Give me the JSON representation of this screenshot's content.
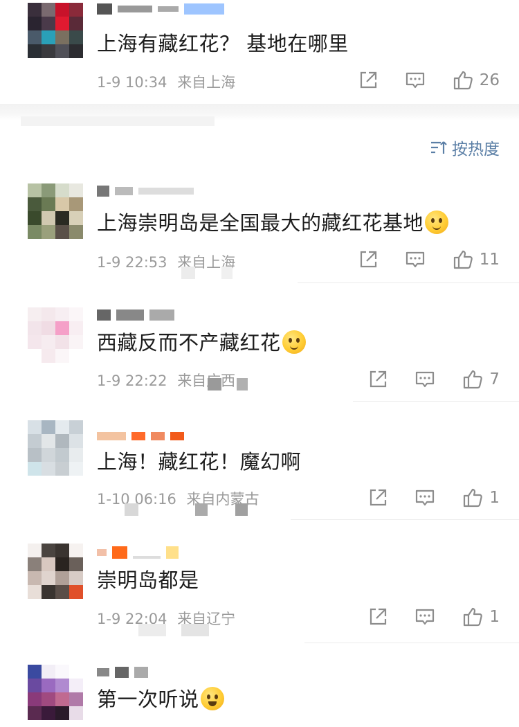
{
  "sort": {
    "icon": "sort-icon",
    "label": "按热度"
  },
  "comments": [
    {
      "content": "上海有藏红花？  基地在哪里",
      "emoji": "",
      "time": "1-9 10:34",
      "location": "来自上海",
      "likes": "26"
    },
    {
      "content": "上海崇明岛是全国最大的藏红花基地",
      "emoji": "thinking-emoji",
      "time": "1-9 22:53",
      "location": "来自上海",
      "likes": "11"
    },
    {
      "content": "西藏反而不产藏红花",
      "emoji": "thinking-emoji",
      "time": "1-9 22:22",
      "location": "来自广西",
      "likes": "7"
    },
    {
      "content": "上海！藏红花！魔幻啊",
      "emoji": "",
      "time": "1-10 06:16",
      "location": "来自内蒙古",
      "likes": "1"
    },
    {
      "content": "崇明岛都是",
      "emoji": "",
      "time": "1-9 22:04",
      "location": "来自辽宁",
      "likes": "1"
    },
    {
      "content": "第一次听说",
      "emoji": "laughing-crying-emoji",
      "time": "",
      "location": "",
      "likes": ""
    }
  ],
  "colors": {
    "meta_gray": "#9a9a9a",
    "icon_gray": "#8c8c8c",
    "sort_blue": "#5b7fa6",
    "divider": "#ececec"
  }
}
